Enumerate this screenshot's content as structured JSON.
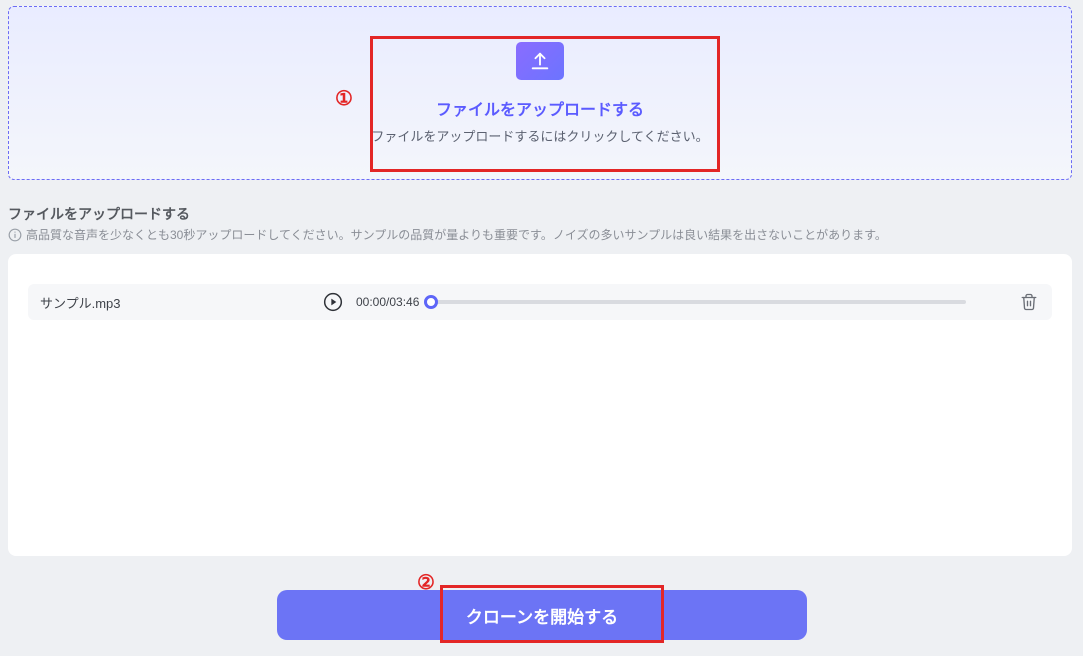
{
  "dropzone": {
    "title": "ファイルをアップロードする",
    "subtitle": "ファイルをアップロードするにはクリックしてください。"
  },
  "annotations": {
    "one": "①",
    "two": "②"
  },
  "section": {
    "title": "ファイルをアップロードする",
    "hint": "高品質な音声を少なくとも30秒アップロードしてください。サンプルの品質が量よりも重要です。ノイズの多いサンプルは良い結果を出さないことがあります。"
  },
  "file": {
    "name": "サンプル.mp3",
    "current_time": "00:00",
    "duration": "03:46",
    "progress_percent": 0
  },
  "primary_button": {
    "label": "クローンを開始する"
  },
  "colors": {
    "accent": "#6c74f5",
    "annotation": "#e32626"
  }
}
